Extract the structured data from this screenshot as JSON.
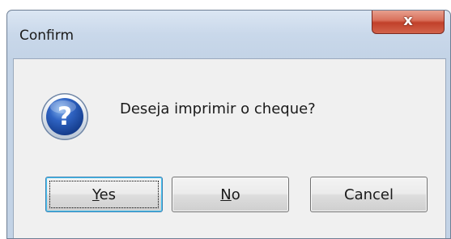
{
  "window": {
    "title": "Confirm",
    "close_glyph": "x"
  },
  "dialog": {
    "icon": "question-icon",
    "icon_glyph": "?",
    "message": "Deseja imprimir o cheque?"
  },
  "buttons": {
    "yes": {
      "accel": "Y",
      "rest": "es"
    },
    "no": {
      "accel": "N",
      "rest": "o"
    },
    "cancel": {
      "label": "Cancel"
    }
  },
  "colors": {
    "close_red": "#c1402a",
    "icon_blue": "#1f4fa8",
    "focus_blue": "#3c7fb1"
  }
}
